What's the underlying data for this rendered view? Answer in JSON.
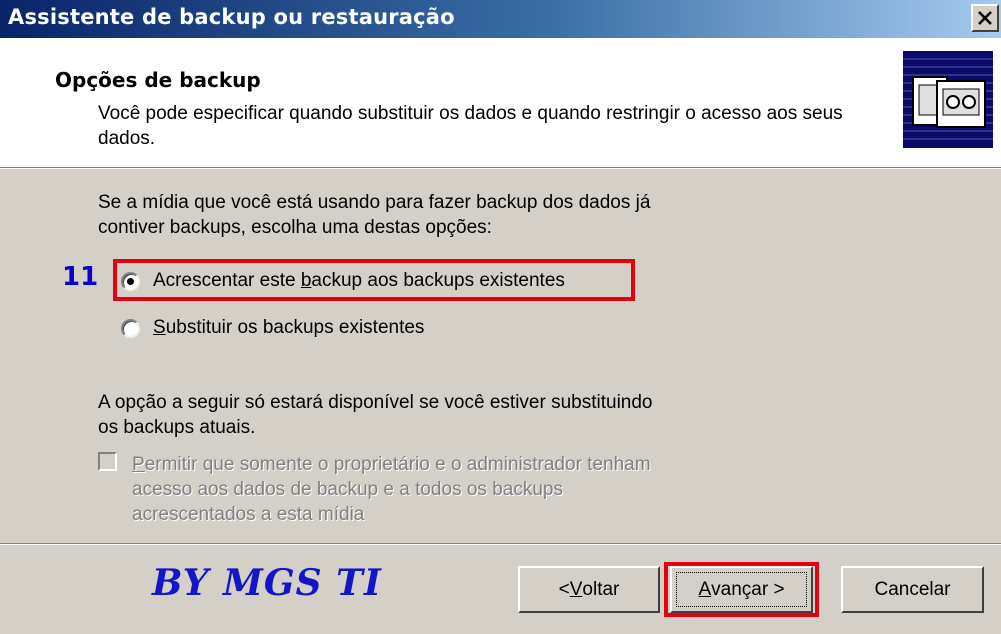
{
  "window": {
    "title": "Assistente de backup ou restauração",
    "close_icon": "close-icon"
  },
  "header": {
    "title": "Opções de backup",
    "description": "Você pode especificar quando substituir os dados e quando restringir o acesso aos seus dados.",
    "icon": "backup-tape-icon"
  },
  "main": {
    "intro": "Se a mídia que você está usando para fazer backup dos dados já contiver backups, escolha uma destas opções:",
    "step_marker": "11",
    "options": [
      {
        "pre": "Acrescentar este ",
        "key": "b",
        "post": "ackup aos backups existentes",
        "selected": true
      },
      {
        "pre": "",
        "key": "S",
        "post": "ubstituir os backups existentes",
        "selected": false
      }
    ],
    "note": "A opção a seguir só estará disponível se você estiver substituindo os backups atuais.",
    "restrict_checkbox": {
      "key": "P",
      "label": "ermitir que somente o proprietário e o administrador tenham acesso aos dados de backup e a todos os backups acrescentados a esta mídia",
      "checked": false,
      "disabled": true
    }
  },
  "footer": {
    "watermark": "BY MGS TI",
    "back_key": "V",
    "back_pre": "< ",
    "back_post": "oltar",
    "next_key": "A",
    "next_post": "vançar >",
    "cancel_label": "Cancelar"
  },
  "colors": {
    "highlight": "#e3000f",
    "title_bar": "#0a246a",
    "dialog_bg": "#d4d0c8",
    "marker": "#0a00cc"
  }
}
